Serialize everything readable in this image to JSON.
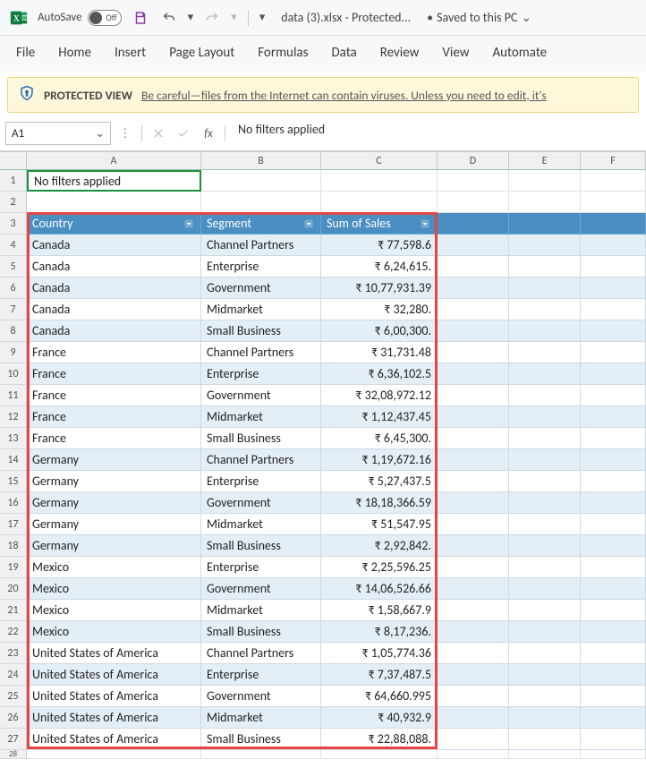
{
  "titlebar": {
    "autosave_label": "AutoSave",
    "autosave_state": "Off",
    "filename": "data (3).xlsx  -  Protected...",
    "saved_status": "Saved to this PC"
  },
  "ribbon": {
    "tabs": [
      "File",
      "Home",
      "Insert",
      "Page Layout",
      "Formulas",
      "Data",
      "Review",
      "View",
      "Automate"
    ]
  },
  "protected": {
    "label": "PROTECTED VIEW",
    "message": "Be careful—files from the Internet can contain viruses. Unless you need to edit, it's"
  },
  "namebox": {
    "ref": "A1"
  },
  "formula_bar": {
    "value": "No filters applied"
  },
  "columns": [
    "A",
    "B",
    "C",
    "D",
    "E",
    "F"
  ],
  "cell_a1": "No filters applied",
  "pivot": {
    "headers": [
      "Country",
      "Segment",
      "Sum of  Sales"
    ],
    "rows": [
      {
        "n": 4,
        "band": true,
        "country": "Canada",
        "segment": "Channel Partners",
        "sales": "₹ 77,598.6"
      },
      {
        "n": 5,
        "band": false,
        "country": "Canada",
        "segment": "Enterprise",
        "sales": "₹ 6,24,615."
      },
      {
        "n": 6,
        "band": true,
        "country": "Canada",
        "segment": "Government",
        "sales": "₹ 10,77,931.39"
      },
      {
        "n": 7,
        "band": false,
        "country": "Canada",
        "segment": "Midmarket",
        "sales": "₹ 32,280."
      },
      {
        "n": 8,
        "band": true,
        "country": "Canada",
        "segment": "Small Business",
        "sales": "₹ 6,00,300."
      },
      {
        "n": 9,
        "band": false,
        "country": "France",
        "segment": "Channel Partners",
        "sales": "₹ 31,731.48"
      },
      {
        "n": 10,
        "band": true,
        "country": "France",
        "segment": "Enterprise",
        "sales": "₹ 6,36,102.5"
      },
      {
        "n": 11,
        "band": false,
        "country": "France",
        "segment": "Government",
        "sales": "₹ 32,08,972.12"
      },
      {
        "n": 12,
        "band": true,
        "country": "France",
        "segment": "Midmarket",
        "sales": "₹ 1,12,437.45"
      },
      {
        "n": 13,
        "band": false,
        "country": "France",
        "segment": "Small Business",
        "sales": "₹ 6,45,300."
      },
      {
        "n": 14,
        "band": true,
        "country": "Germany",
        "segment": "Channel Partners",
        "sales": "₹ 1,19,672.16"
      },
      {
        "n": 15,
        "band": false,
        "country": "Germany",
        "segment": "Enterprise",
        "sales": "₹ 5,27,437.5"
      },
      {
        "n": 16,
        "band": true,
        "country": "Germany",
        "segment": "Government",
        "sales": "₹ 18,18,366.59"
      },
      {
        "n": 17,
        "band": false,
        "country": "Germany",
        "segment": "Midmarket",
        "sales": "₹ 51,547.95"
      },
      {
        "n": 18,
        "band": true,
        "country": "Germany",
        "segment": "Small Business",
        "sales": "₹ 2,92,842."
      },
      {
        "n": 19,
        "band": false,
        "country": "Mexico",
        "segment": "Enterprise",
        "sales": "₹ 2,25,596.25"
      },
      {
        "n": 20,
        "band": true,
        "country": "Mexico",
        "segment": "Government",
        "sales": "₹ 14,06,526.66"
      },
      {
        "n": 21,
        "band": false,
        "country": "Mexico",
        "segment": "Midmarket",
        "sales": "₹ 1,58,667.9"
      },
      {
        "n": 22,
        "band": true,
        "country": "Mexico",
        "segment": "Small Business",
        "sales": "₹ 8,17,236."
      },
      {
        "n": 23,
        "band": false,
        "country": "United States of America",
        "segment": "Channel Partners",
        "sales": "₹ 1,05,774.36"
      },
      {
        "n": 24,
        "band": true,
        "country": "United States of America",
        "segment": "Enterprise",
        "sales": "₹ 7,37,487.5"
      },
      {
        "n": 25,
        "band": false,
        "country": "United States of America",
        "segment": "Government",
        "sales": "₹ 64,660.995"
      },
      {
        "n": 26,
        "band": true,
        "country": "United States of America",
        "segment": "Midmarket",
        "sales": "₹ 40,932.9"
      },
      {
        "n": 27,
        "band": false,
        "country": "United States of America",
        "segment": "Small Business",
        "sales": "₹ 22,88,088."
      }
    ]
  }
}
